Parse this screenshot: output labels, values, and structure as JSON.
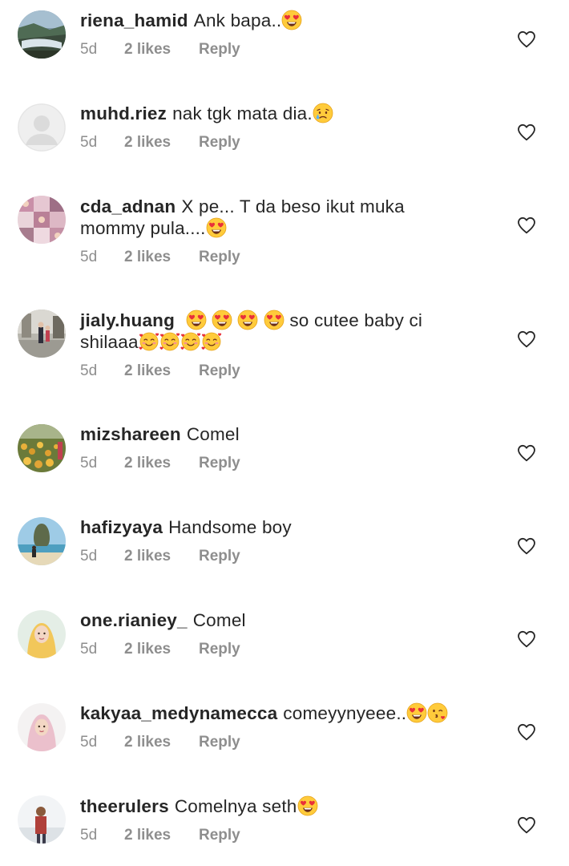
{
  "comments": [
    {
      "username": "riena_hamid",
      "text_segments": [
        "Ank bapa.."
      ],
      "trailing_emoji": "heart-eyes-emoji",
      "time": "5d",
      "likes": "2 likes",
      "reply": "Reply",
      "avatar": "waterfall-photo-avatar"
    },
    {
      "username": "muhd.riez",
      "text_segments": [
        "nak tgk mata dia."
      ],
      "trailing_emoji": "crying-face-emoji",
      "time": "5d",
      "likes": "2 likes",
      "reply": "Reply",
      "avatar": "default-grey-avatar"
    },
    {
      "username": "cda_adnan",
      "text_segments": [
        "X pe... T da beso ikut muka mommy pula...."
      ],
      "trailing_emoji": "heart-eyes-emoji",
      "time": "5d",
      "likes": "2 likes",
      "reply": "Reply",
      "avatar": "collage-photo-avatar"
    },
    {
      "username": "jialy.huang",
      "text_segments": [
        "so cutee baby ci shilaaa"
      ],
      "leading_emojis": [
        "heart-eyes-emoji",
        "heart-eyes-emoji",
        "heart-eyes-emoji",
        "heart-eyes-emoji"
      ],
      "trailing_emojis": [
        "smiling-face-with-hearts-emoji",
        "smiling-face-with-hearts-emoji",
        "smiling-face-with-hearts-emoji",
        "smiling-face-with-hearts-emoji"
      ],
      "time": "5d",
      "likes": "2 likes",
      "reply": "Reply",
      "avatar": "street-photo-avatar"
    },
    {
      "username": "mizshareen",
      "text_segments": [
        "Comel"
      ],
      "time": "5d",
      "likes": "2 likes",
      "reply": "Reply",
      "avatar": "flower-field-avatar"
    },
    {
      "username": "hafizyaya",
      "text_segments": [
        "Handsome boy"
      ],
      "time": "5d",
      "likes": "2 likes",
      "reply": "Reply",
      "avatar": "beach-rock-avatar"
    },
    {
      "username": "one.rianiey_",
      "text_segments": [
        "Comel"
      ],
      "time": "5d",
      "likes": "2 likes",
      "reply": "Reply",
      "avatar": "yellow-hijab-avatar"
    },
    {
      "username": "kakyaa_medynamecca",
      "text_segments": [
        "comeyynyeee.."
      ],
      "trailing_emojis": [
        "heart-eyes-emoji",
        "kissing-face-emoji"
      ],
      "time": "5d",
      "likes": "2 likes",
      "reply": "Reply",
      "avatar": "pink-hijab-avatar"
    },
    {
      "username": "theerulers",
      "text_segments": [
        "Comelnya seth"
      ],
      "trailing_emoji": "heart-eyes-emoji",
      "time": "5d",
      "likes": "2 likes",
      "reply": "Reply",
      "avatar": "man-outdoor-avatar"
    }
  ],
  "colors": {
    "text": "#262626",
    "meta": "#8e8e8e",
    "heart_outline": "#8e8e8e",
    "emoji_face": "#FFCC33",
    "emoji_heart": "#E8303A"
  }
}
